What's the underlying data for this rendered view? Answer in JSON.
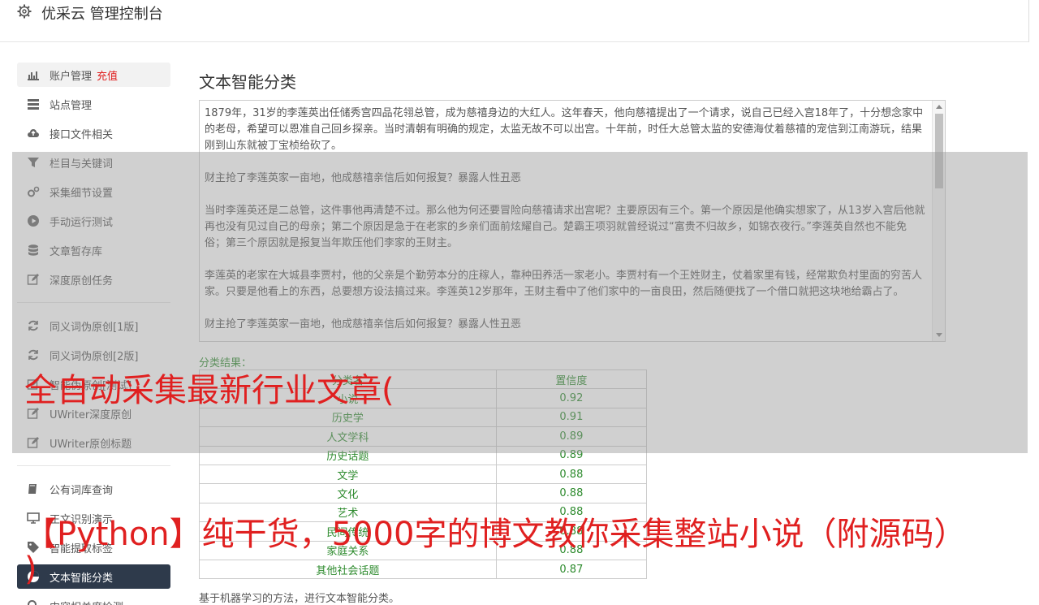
{
  "header": {
    "title": "优采云 管理控制台",
    "icon": "gear-icon"
  },
  "sidebar": {
    "items": [
      {
        "label": "账户管理",
        "badge": "充值",
        "icon": "bar-chart-icon"
      },
      {
        "label": "站点管理",
        "icon": "server-icon"
      },
      {
        "label": "接口文件相关",
        "icon": "cloud-upload-icon"
      },
      {
        "label": "栏目与关键词",
        "icon": "filter-icon"
      },
      {
        "label": "采集细节设置",
        "icon": "cogs-icon"
      },
      {
        "label": "手动运行测试",
        "icon": "play-circle-icon"
      },
      {
        "label": "文章暂存库",
        "icon": "database-icon"
      },
      {
        "label": "深度原创任务",
        "icon": "edit-icon"
      },
      {
        "label": "同义词伪原创[1版]",
        "icon": "refresh-icon"
      },
      {
        "label": "同义词伪原创[2版]",
        "icon": "refresh-icon"
      },
      {
        "label": "智能伪原创[测试]",
        "icon": "edit-icon"
      },
      {
        "label": "UWriter深度原创",
        "icon": "edit-icon"
      },
      {
        "label": "UWriter原创标题",
        "icon": "edit-icon"
      },
      {
        "label": "公有词库查询",
        "icon": "book-icon"
      },
      {
        "label": "正文识别演示",
        "icon": "desktop-icon"
      },
      {
        "label": "智能提取标签",
        "icon": "tag-icon"
      },
      {
        "label": "文本智能分类",
        "icon": "pie-chart-icon"
      },
      {
        "label": "内容相关度检测",
        "icon": "search-icon"
      }
    ]
  },
  "main": {
    "title": "文本智能分类",
    "text_paragraphs": [
      "1879年，31岁的李莲英出任储秀宫四品花翎总管，成为慈禧身边的大红人。这年春天，他向慈禧提出了一个请求，说自己已经入宫18年了，十分想念家中的老母，希望可以恩准自己回乡探亲。当时清朝有明确的规定，太监无故不可以出宫。十年前，时任大总管太监的安德海仗着慈禧的宠信到江南游玩，结果刚到山东就被丁宝桢给砍了。",
      "财主抢了李莲英家一亩地，他成慈禧亲信后如何报复？暴露人性丑恶",
      "当时李莲英还是二总管，这件事他再清楚不过。那么他为何还要冒险向慈禧请求出宫呢？主要原因有三个。第一个原因是他确实想家了，从13岁入宫后他就再也没有见过自己的母亲；第二个原因是急于在老家的乡亲们面前炫耀自己。楚霸王项羽就曾经说过“富贵不归故乡，如锦衣夜行。”李莲英自然也不能免俗；第三个原因就是报复当年欺压他们李家的王财主。",
      "李莲英的老家在大城县李贾村，他的父亲是个勤劳本分的庄稼人，靠种田养活一家老小。李贾村有一个王姓财主，仗着家里有钱，经常欺负村里面的穷苦人家。只要是他看上的东西，总要想方设法搞过来。李莲英12岁那年，王财主看中了他们家中的一亩良田，然后随便找了一个借口就把这块地给霸占了。",
      "财主抢了李莲英家一亩地，他成慈禧亲信后如何报复？暴露人性丑恶"
    ],
    "result_label": "分类结果：",
    "table": {
      "headers": [
        "分类名",
        "置信度"
      ],
      "rows": [
        [
          "小说",
          "0.92"
        ],
        [
          "历史学",
          "0.91"
        ],
        [
          "人文学科",
          "0.89"
        ],
        [
          "历史话题",
          "0.89"
        ],
        [
          "文学",
          "0.88"
        ],
        [
          "文化",
          "0.88"
        ],
        [
          "艺术",
          "0.88"
        ],
        [
          "民间传统",
          "0.88"
        ],
        [
          "家庭关系",
          "0.88"
        ],
        [
          "其他社会话题",
          "0.87"
        ]
      ]
    },
    "footer_note": "基于机器学习的方法，进行文本智能分类。"
  },
  "overlay": {
    "headline1": "全自动采集最新行业文章(",
    "headline2": "【Python】纯干货，5000字的博文教你采集整站小说（附源码）",
    "headline3": ")"
  },
  "colors": {
    "accent_red": "#e02020",
    "active_nav": "#2e3a4b",
    "result_green": "#2e8b2e"
  }
}
